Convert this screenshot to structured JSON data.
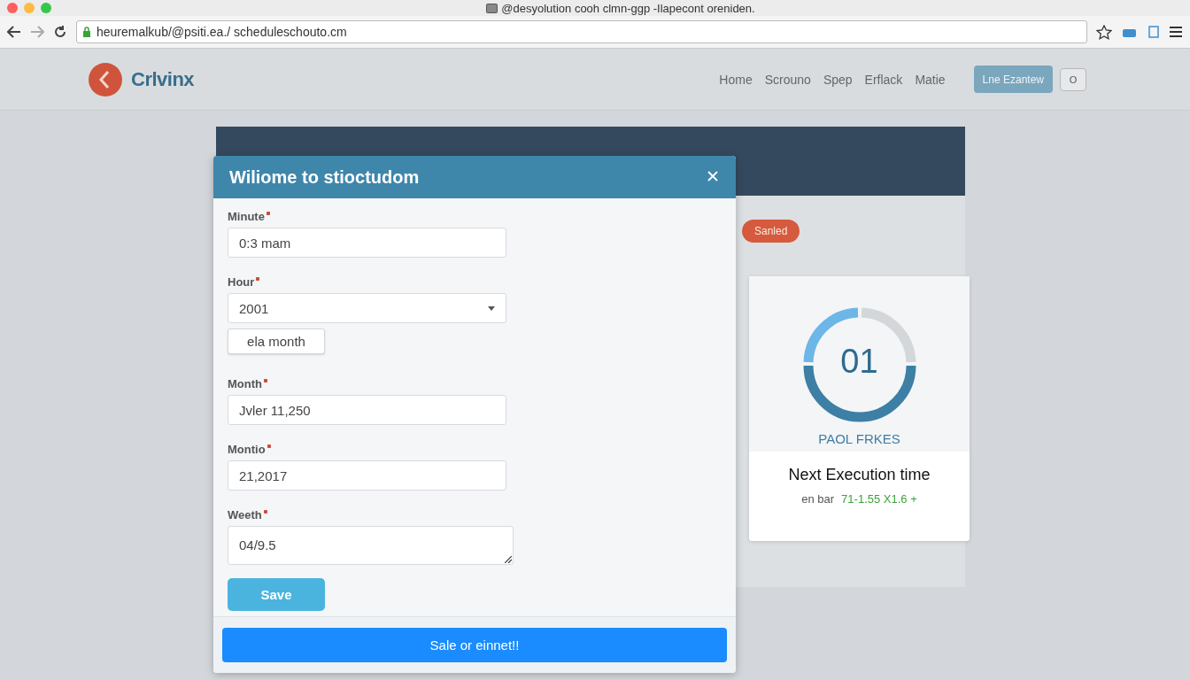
{
  "browser": {
    "tab_title": "@desyolution cooh clmn-ggp -Ilapecont oreniden.",
    "address": "heuremalkub/@psiti.ea./ scheduleschouto.cm"
  },
  "site": {
    "logo_text": "Crlvinx",
    "nav": [
      {
        "label": "Home"
      },
      {
        "label": "Scrouno"
      },
      {
        "label": "Spep"
      },
      {
        "label": "Erflack"
      },
      {
        "label": "Matie"
      }
    ],
    "cta": "Lne Ezantew",
    "small_button": "O"
  },
  "status_badge": "Sanled",
  "gauge_card": {
    "value": "01",
    "caption": "PAOL FRKES",
    "title": "Next Execution time",
    "detail_prefix": "en bar",
    "detail_value": "71-1.55 X1.6 +"
  },
  "modal": {
    "title": "Wiliome to stioctudom",
    "fields": [
      {
        "kind": "text",
        "label": "Minute",
        "required": true,
        "value": "0:3 mam"
      },
      {
        "kind": "select",
        "label": "Hour",
        "required": true,
        "value": "2001"
      },
      {
        "kind": "chip",
        "label": "ela month"
      },
      {
        "kind": "text",
        "label": "Month",
        "required": true,
        "value": "Jvler 11,250"
      },
      {
        "kind": "text",
        "label": "Montio",
        "required": true,
        "value": "21,2017"
      },
      {
        "kind": "textarea",
        "label": "Weeth",
        "required": true,
        "value": "04/9.5"
      }
    ],
    "save": "Save",
    "footer_button": "Sale or einnet!!"
  }
}
